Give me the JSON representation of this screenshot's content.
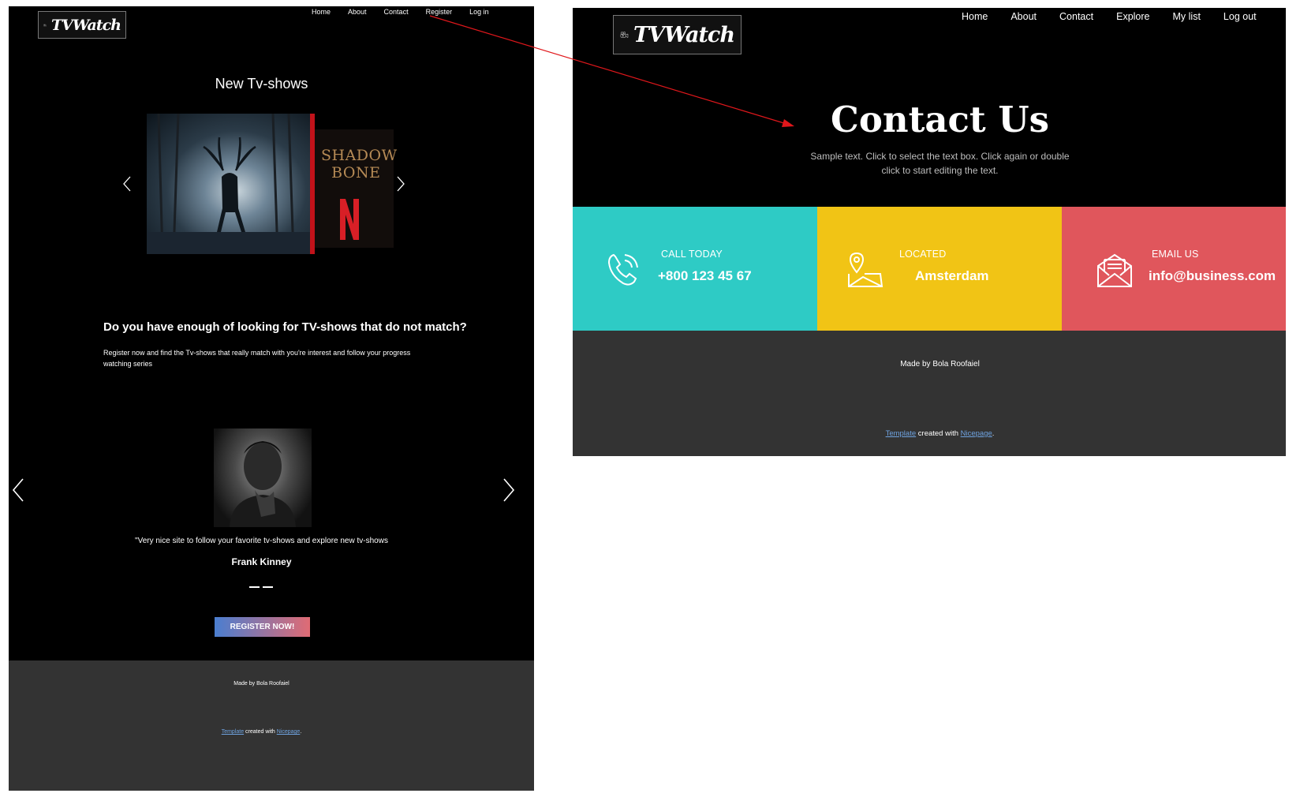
{
  "left_page": {
    "logo": {
      "text": "TVWatch"
    },
    "nav": [
      "Home",
      "About",
      "Contact",
      "Register",
      "Log in"
    ],
    "new_shows": {
      "heading": "New Tv-shows",
      "poster_text": "SHADOW\nBONE",
      "netflix_letter": "N"
    },
    "promo": {
      "heading": "Do you have enough of looking for TV-shows that do not match?",
      "text": "Register now and find the Tv-shows that really match with you're interest and follow your progress watching series"
    },
    "testimonial": {
      "quote": "\"Very nice site to follow your favorite tv-shows and explore new tv-shows",
      "name": "Frank Kinney"
    },
    "register_button": "REGISTER NOW!",
    "footer": {
      "made_by": "Made by Bola Roofaiel",
      "template_link": "Template",
      "created_with": " created with ",
      "nicepage_link": "Nicepage",
      "period": "."
    }
  },
  "right_page": {
    "logo": {
      "text": "TVWatch"
    },
    "nav": [
      "Home",
      "About",
      "Contact",
      "Explore",
      "My list",
      "Log out"
    ],
    "title": "Contact Us",
    "subtitle": "Sample text. Click to select the text box. Click again or double click to start editing the text.",
    "cards": [
      {
        "label": "CALL TODAY",
        "value": "+800 123 45 67",
        "icon": "phone-icon",
        "color": "#2ecbc5"
      },
      {
        "label": "LOCATED",
        "value": "Amsterdam",
        "icon": "map-pin-icon",
        "color": "#f1c415"
      },
      {
        "label": "EMAIL US",
        "value": "info@business.com",
        "icon": "envelope-icon",
        "color": "#e0565c"
      }
    ],
    "footer": {
      "made_by": "Made by Bola Roofaiel",
      "template_link": "Template",
      "created_with": " created with ",
      "nicepage_link": "Nicepage",
      "period": "."
    }
  },
  "annotation": {
    "color": "#e0171b"
  }
}
